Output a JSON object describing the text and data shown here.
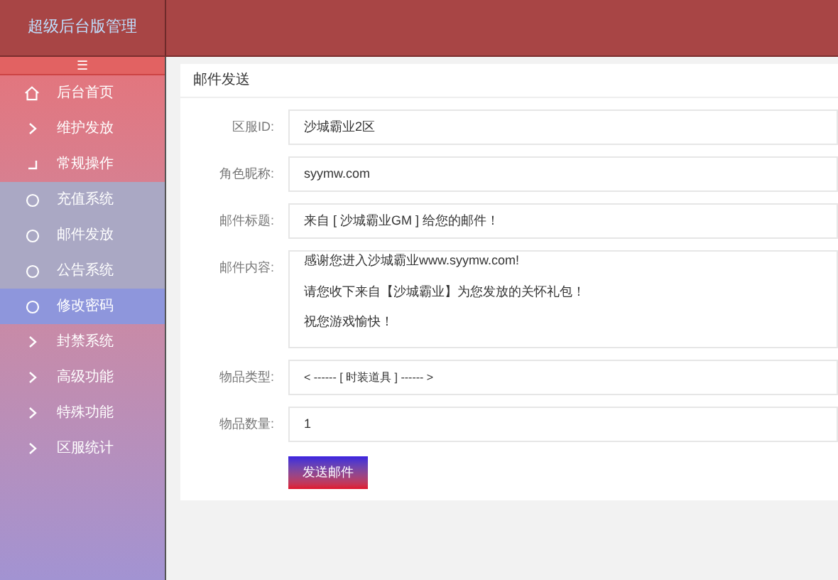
{
  "header": {
    "title": "超级后台版管理"
  },
  "sidebar": {
    "toggle": "☰",
    "items": [
      {
        "label": "后台首页",
        "kind": "home"
      },
      {
        "label": "维护发放",
        "kind": "folder",
        "expanded": false
      },
      {
        "label": "常规操作",
        "kind": "folder",
        "expanded": true,
        "children": [
          {
            "label": "充值系统",
            "selected": false
          },
          {
            "label": "邮件发放",
            "selected": false
          },
          {
            "label": "公告系统",
            "selected": false
          },
          {
            "label": "修改密码",
            "selected": true
          }
        ]
      },
      {
        "label": "封禁系统",
        "kind": "folder",
        "expanded": false
      },
      {
        "label": "高级功能",
        "kind": "folder",
        "expanded": false
      },
      {
        "label": "特殊功能",
        "kind": "folder",
        "expanded": false
      },
      {
        "label": "区服统计",
        "kind": "folder",
        "expanded": false
      }
    ]
  },
  "panel": {
    "title": "邮件发送",
    "fields": [
      {
        "label": "区服ID:",
        "value": "沙城霸业2区",
        "kind": "input"
      },
      {
        "label": "角色昵称:",
        "value": "syymw.com",
        "kind": "input"
      },
      {
        "label": "邮件标题:",
        "value": "来自 [ 沙城霸业GM ] 给您的邮件！",
        "kind": "input"
      },
      {
        "label": "邮件内容:",
        "lines": [
          "感谢您进入沙城霸业www.syymw.com!",
          "请您收下来自【沙城霸业】为您发放的关怀礼包！",
          "祝您游戏愉快！"
        ],
        "kind": "textarea"
      },
      {
        "label": "物品类型:",
        "value": "< ------ [ 时装道具 ] ------ >",
        "kind": "select"
      },
      {
        "label": "物品数量:",
        "value": "1",
        "kind": "input"
      }
    ],
    "submit": "发送邮件"
  }
}
